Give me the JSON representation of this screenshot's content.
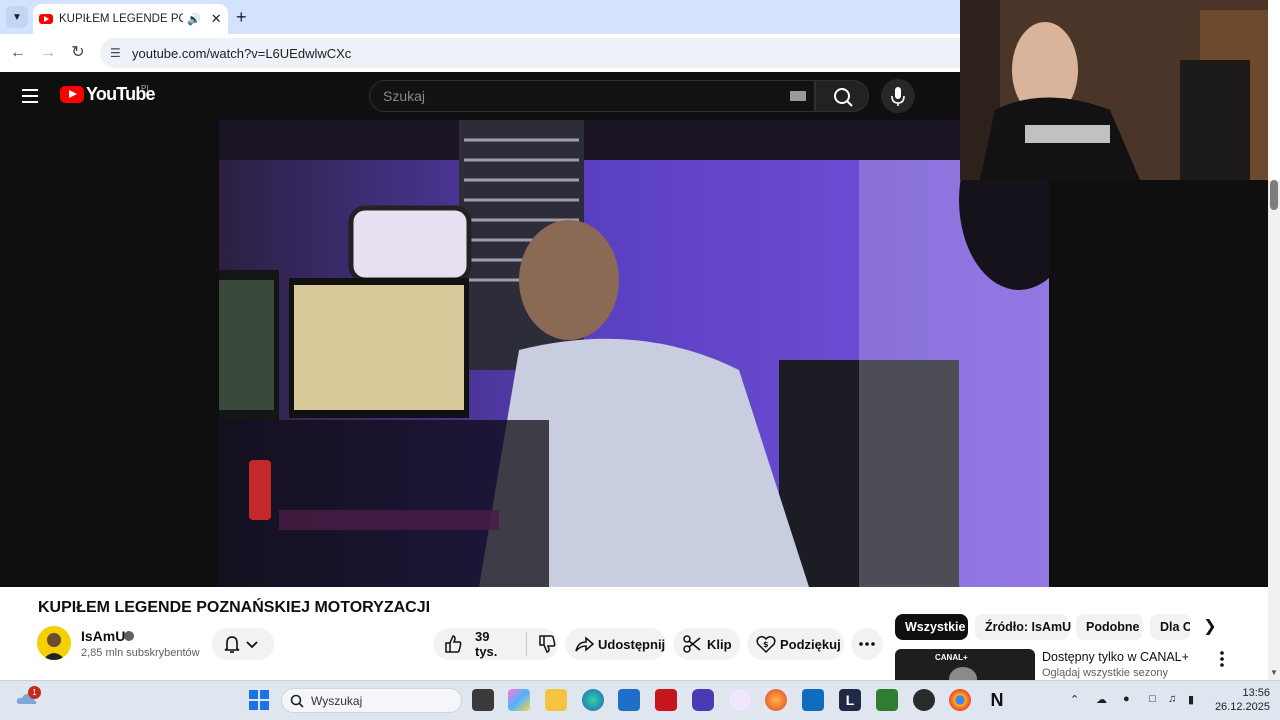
{
  "browser": {
    "tab_title": "KUPIŁEM LEGENDE POZNA",
    "url": "youtube.com/watch?v=L6UEdwlwCXc",
    "icons": [
      "tab-dropdown-icon",
      "youtube-favicon-icon",
      "audio-icon",
      "close-icon",
      "plus-icon",
      "back-icon",
      "forward-icon",
      "reload-icon",
      "site-info-icon"
    ]
  },
  "header": {
    "logo_text": "YouTube",
    "logo_country": "PL",
    "search_placeholder": "Szukaj",
    "icons": [
      "menu-icon",
      "keyboard-icon",
      "search-icon",
      "mic-icon"
    ]
  },
  "video": {
    "title": "KUPIŁEM LEGENDE POZNAŃSKIEJ MOTORYZACJI"
  },
  "channel": {
    "name": "IsAmU",
    "subscribers": "2,85 mln subskrybentów"
  },
  "actions": {
    "likes": "39 tys.",
    "share": "Udostępnij",
    "clip": "Klip",
    "thanks": "Podziękuj"
  },
  "chips": [
    "Wszystkie",
    "Źródło: IsAmU",
    "Podobne",
    "Dla C"
  ],
  "recommendation": {
    "title": "Dostępny tylko w CANAL+",
    "subtitle": "Oglądaj wszystkie sezony",
    "thumb_label": "CANAL+"
  },
  "taskbar": {
    "search": "Wyszukaj",
    "weather_badge": "1",
    "time": "13:56",
    "date": "26.12.2025"
  },
  "colors": {
    "youtube_red": "#ff0000",
    "dark_bg": "#0f0f0f",
    "tab_strip": "#d3e3fd"
  }
}
